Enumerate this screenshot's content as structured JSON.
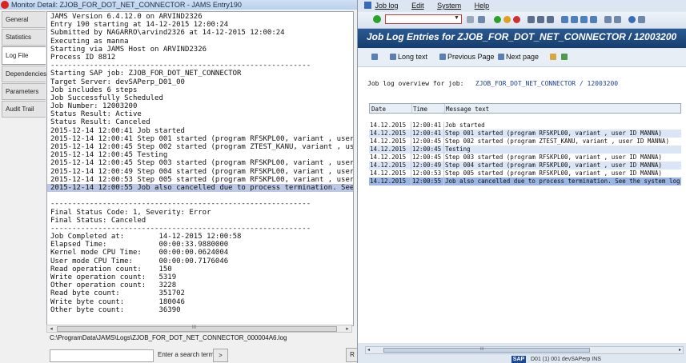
{
  "jams": {
    "title": "Monitor Detail: ZJOB_FOR_DOT_NET_CONNECTOR - JAMS Entry190",
    "tabs": [
      "General",
      "Statistics",
      "Log File",
      "Dependencies",
      "Parameters",
      "Audit Trail"
    ],
    "active_tab": "Log File",
    "log_lines": [
      "JAMS Version 6.4.12.0 on ARVIND2326",
      "Entry 190 starting at 14-12-2015 12:00:24",
      "Submitted by NAGARRO\\arvind2326 at 14-12-2015 12:00:24",
      "Executing as manna",
      "Starting via JAMS Host on ARVIND2326",
      "Process ID 8812",
      "------------------------------------------------------------",
      "Starting SAP job: ZJOB_FOR_DOT_NET_CONNECTOR",
      "Target Server: devSAPerp_D01_00",
      "Job includes 6 steps",
      "Job Successfully Scheduled",
      "Job Number: 12003200",
      "Status Result: Active",
      "Status Result: Canceled",
      "2015-12-14 12:00:41 Job started",
      "2015-12-14 12:00:41 Step 001 started (program RFSKPL00, variant , user ID",
      "2015-12-14 12:00:45 Step 002 started (program ZTEST_KANU, variant , user",
      "2015-12-14 12:00:45 Testing",
      "2015-12-14 12:00:45 Step 003 started (program RFSKPL00, variant , user ID",
      "2015-12-14 12:00:49 Step 004 started (program RFSKPL00, variant , user ID",
      "2015-12-14 12:00:53 Step 005 started (program RFSKPL00, variant , user ID",
      "2015-12-14 12:00:55 Job also cancelled due to process termination. See th",
      "",
      "------------------------------------------------------------",
      "Final Status Code: 1, Severity: Error",
      "Final Status: Canceled",
      "------------------------------------------------------------",
      "Job Completed at:        14-12-2015 12:00:58",
      "Elapsed Time:            00:00:33.9880000",
      "Kernel mode CPU Time:    00:00:00.0624004",
      "User mode CPU Time:      00:00:00.7176046",
      "Read operation count:    150",
      "Write operation count:   5319",
      "Other operation count:   3228",
      "Read byte count:         351702",
      "Write byte count:        180046",
      "Other byte count:        36390"
    ],
    "highlighted_line": 21,
    "scroll_left": "◂",
    "scroll_right": "▸",
    "scroll_grip": "III",
    "file_path": "C:\\ProgramData\\JAMS\\Logs\\ZJOB_FOR_DOT_NET_CONNECTOR_000004A6.log",
    "search_hint": "Enter a search term...",
    "search_button": ">",
    "right_button": "R"
  },
  "sap": {
    "menu": [
      "Job log",
      "Edit",
      "System",
      "Help"
    ],
    "title": "Job Log Entries for ZJOB_FOR_DOT_NET_CONNECTOR / 12003200",
    "app_buttons": [
      "Long text",
      "Previous Page",
      "Next page"
    ],
    "overview_label": "Job log overview for job:",
    "overview_job": "ZJOB_FOR_DOT_NET_CONNECTOR / 12003200",
    "columns": [
      "Date",
      "Time",
      "Message text"
    ],
    "rows": [
      {
        "date": "14.12.2015",
        "time": "12:00:41",
        "msg": "Job started"
      },
      {
        "date": "14.12.2015",
        "time": "12:00:41",
        "msg": "Step 001 started (program RFSKPL00, variant , user ID MANNA)"
      },
      {
        "date": "14.12.2015",
        "time": "12:00:45",
        "msg": "Step 002 started (program ZTEST_KANU, variant , user ID MANNA)"
      },
      {
        "date": "14.12.2015",
        "time": "12:00:45",
        "msg": "Testing"
      },
      {
        "date": "14.12.2015",
        "time": "12:00:45",
        "msg": "Step 003 started (program RFSKPL00, variant , user ID MANNA)"
      },
      {
        "date": "14.12.2015",
        "time": "12:00:49",
        "msg": "Step 004 started (program RFSKPL00, variant , user ID MANNA)"
      },
      {
        "date": "14.12.2015",
        "time": "12:00:53",
        "msg": "Step 005 started (program RFSKPL00, variant , user ID MANNA)"
      },
      {
        "date": "14.12.2015",
        "time": "12:00:55",
        "msg": "Job also cancelled due to process termination. See the system log"
      }
    ],
    "selected_row": 7,
    "scroll_left": "◂",
    "scroll_right": "▸",
    "scroll_grip": "III",
    "logo_text": "SAP",
    "status_text": "D01 (1) 001   devSAPerp   INS",
    "colors": {
      "title_bg": "#1f4a80",
      "selected_row": "#9bb6e2",
      "alt_row": "#dae6f5"
    }
  }
}
